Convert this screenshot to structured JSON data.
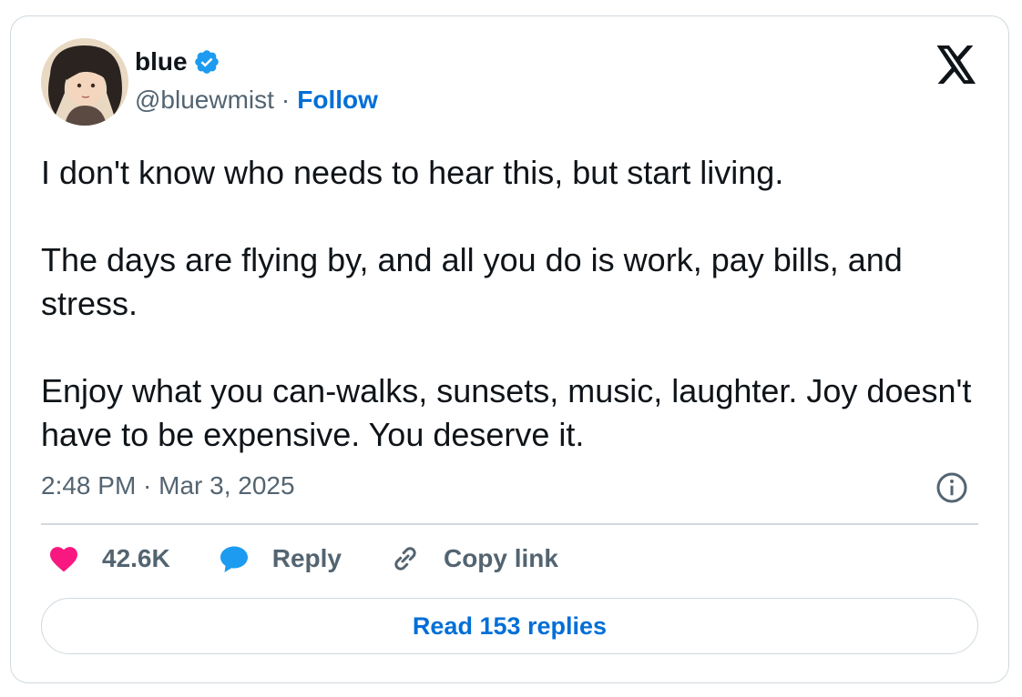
{
  "author": {
    "name": "blue",
    "handle": "@bluewmist",
    "separator": "·",
    "follow_label": "Follow",
    "verified_icon": "verified-badge-icon"
  },
  "tweet": {
    "text": "I don't know who needs to hear this, but start living.\n\nThe days are flying by, and all you do is work, pay bills, and stress.\n\nEnjoy what you can-walks, sunsets, music, laughter. Joy doesn't have to be expensive. You deserve it.",
    "timestamp": "2:48 PM · Mar 3, 2025"
  },
  "actions": {
    "likes": "42.6K",
    "reply_label": "Reply",
    "copy_link_label": "Copy link"
  },
  "footer": {
    "read_replies_label": "Read 153 replies"
  },
  "colors": {
    "accent": "#006fd6",
    "like": "#f91880",
    "reply": "#1d9bf0",
    "muted": "#536471",
    "border": "#cfd9de"
  }
}
